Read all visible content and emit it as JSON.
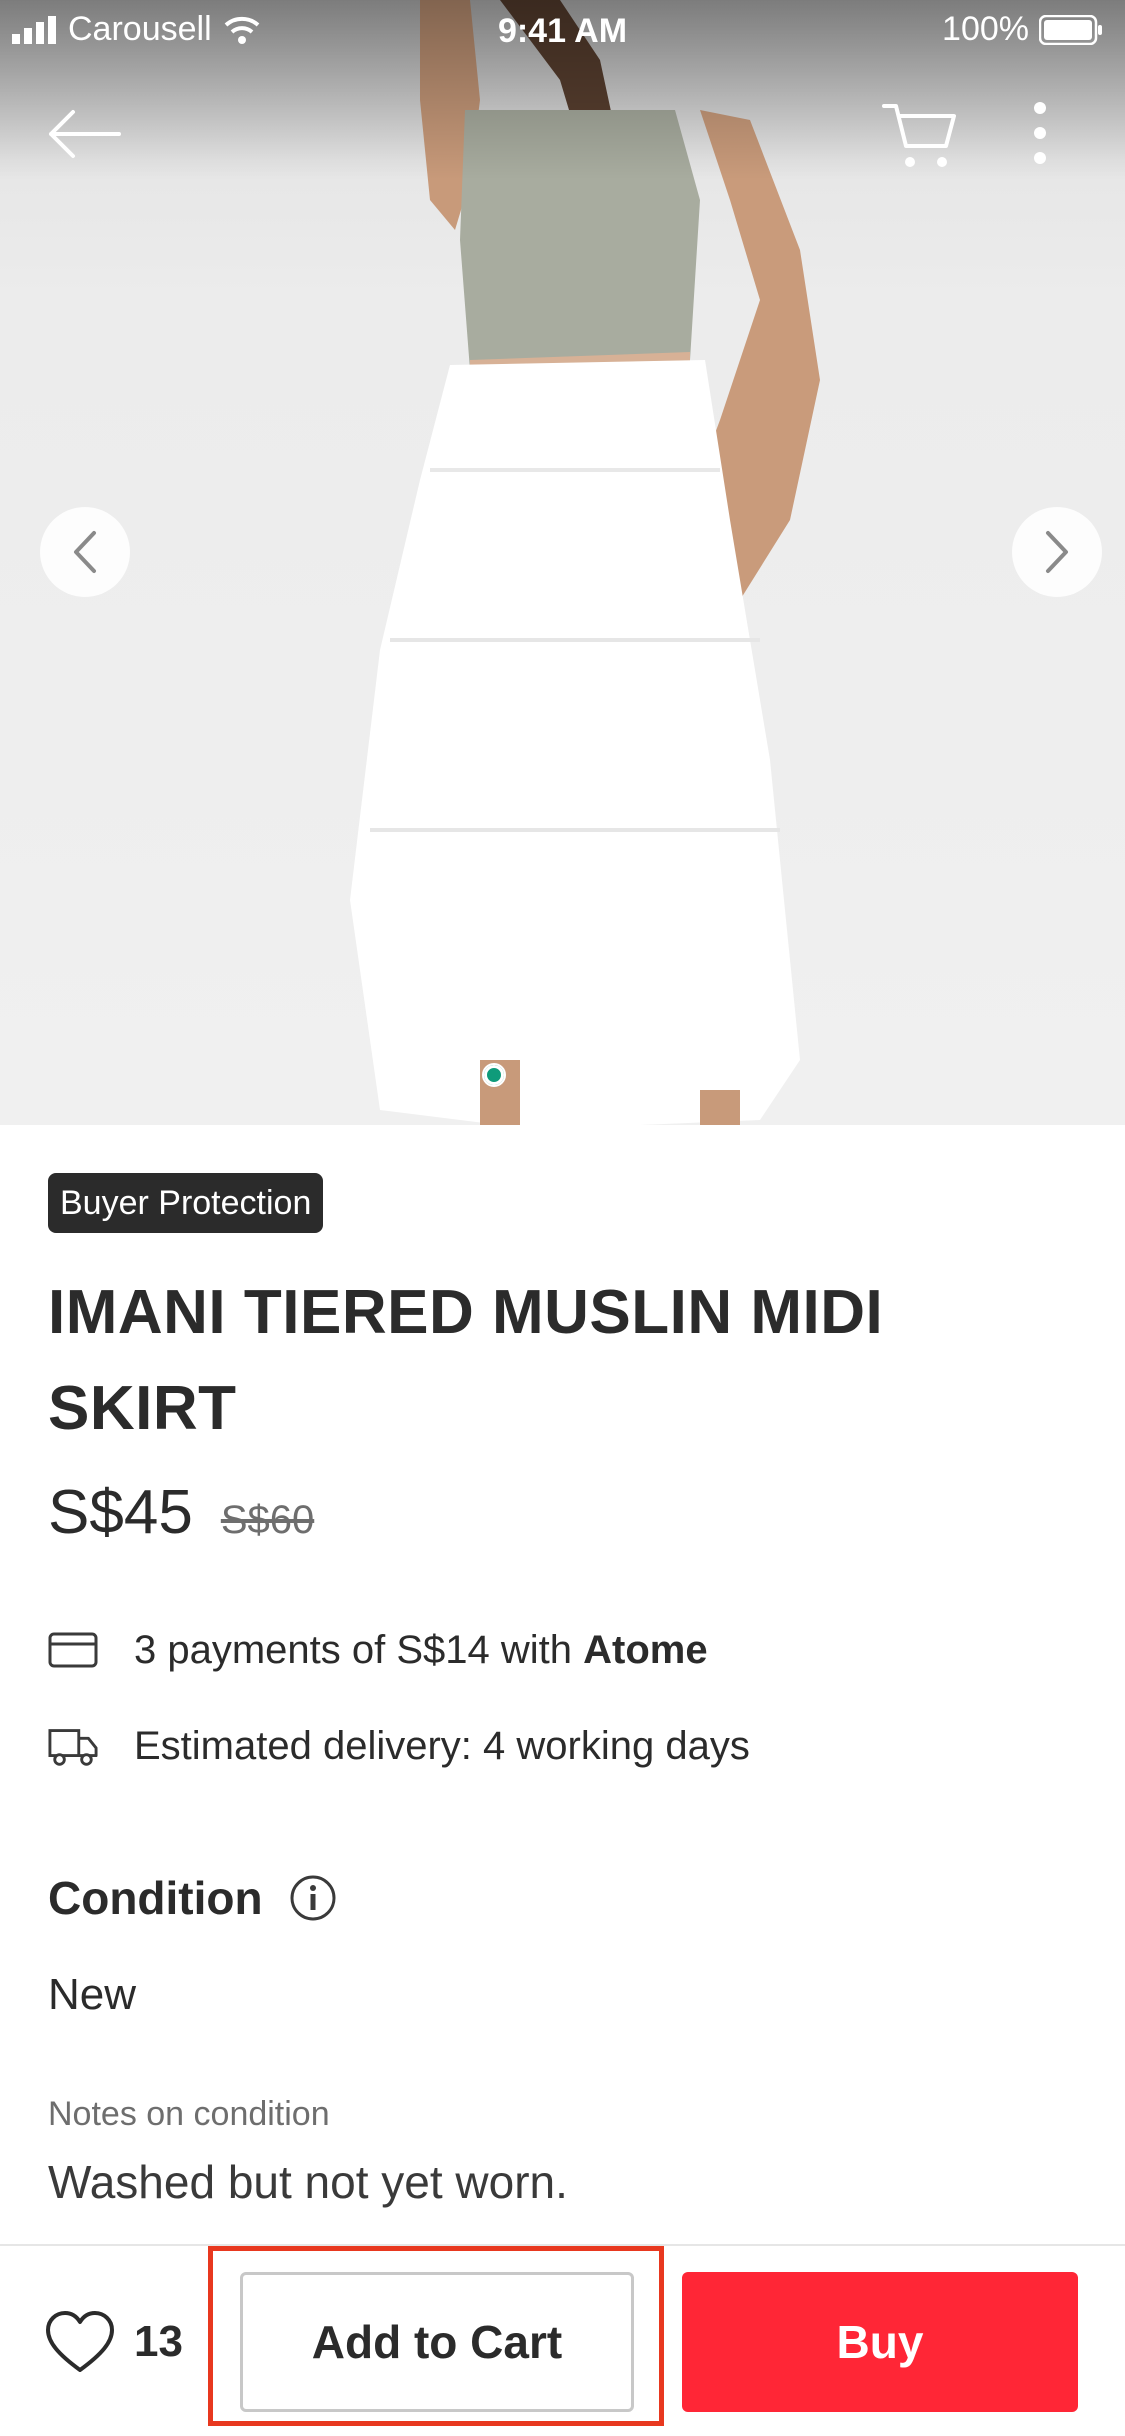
{
  "status_bar": {
    "carrier": "Carousell",
    "time": "9:41 AM",
    "battery": "100%"
  },
  "hero": {
    "image_count": 4,
    "active_image": 1,
    "icons": {
      "back": "back-arrow-icon",
      "cart": "cart-icon",
      "more": "more-vertical-icon",
      "prev": "chevron-left-icon",
      "next": "chevron-right-icon"
    }
  },
  "listing": {
    "badge": "Buyer Protection",
    "title": "IMANI TIERED MUSLIN MIDI SKIRT",
    "price": "S$45",
    "original_price": "S$60",
    "payments_text": "3 payments of S$14 with",
    "payments_brand": "Atome",
    "delivery_text": "Estimated delivery: 4 working days"
  },
  "condition": {
    "heading": "Condition",
    "value": "New",
    "notes_label": "Notes on condition",
    "notes_value": "Washed but not yet worn."
  },
  "bottom_bar": {
    "like_count": "13",
    "add_to_cart": "Add to Cart",
    "buy": "Buy"
  },
  "colors": {
    "buy_button": "#ff2636",
    "highlight_box": "#e8381f",
    "badge_bg": "#2b2b2b",
    "active_dot": "#0f9b7a"
  }
}
